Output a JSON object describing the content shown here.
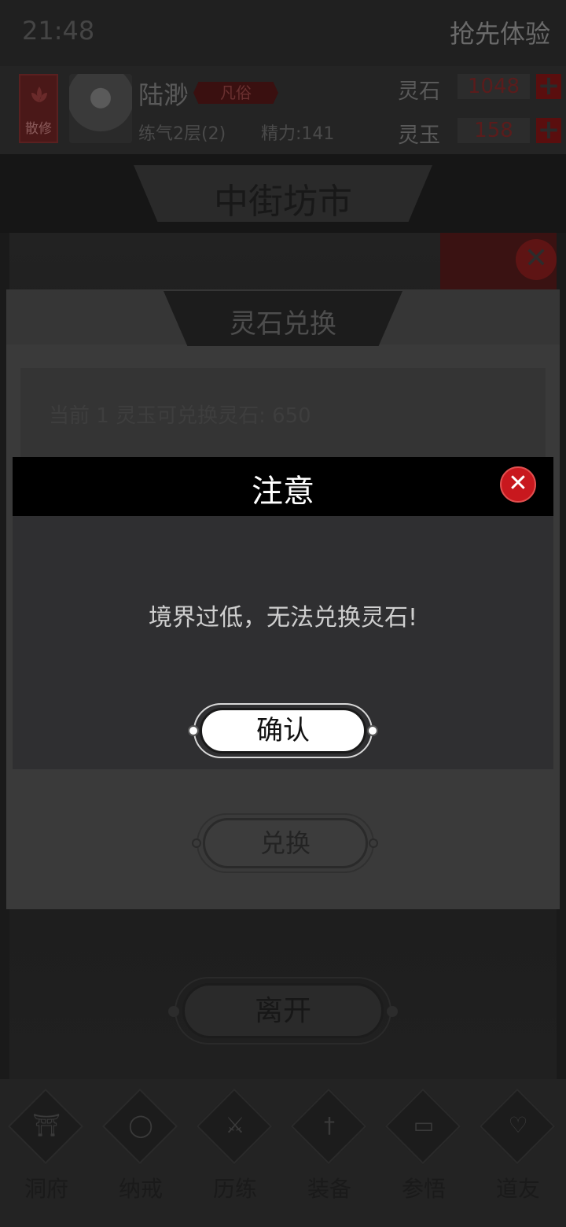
{
  "status": {
    "time": "21:48",
    "right_text": "抢先体验"
  },
  "player": {
    "sect": "散修",
    "name": "陆渺",
    "rank": "凡俗",
    "level": "练气2层(2)",
    "energy": "精力:141"
  },
  "currencies": [
    {
      "label": "灵石",
      "value": "1048",
      "plus": "+"
    },
    {
      "label": "灵玉",
      "value": "158",
      "plus": "+"
    }
  ],
  "location": {
    "title": "中街坊市"
  },
  "exchange_panel": {
    "title": "灵石兑换",
    "rate_text": "当前 1 灵玉可兑换灵石: 650",
    "exchange_button": "兑换",
    "close_glyph": "✕"
  },
  "leave_button": "离开",
  "bottom_nav": [
    {
      "label": "洞府",
      "icon": "gate-icon"
    },
    {
      "label": "纳戒",
      "icon": "ring-icon"
    },
    {
      "label": "历练",
      "icon": "crossed-swords-icon"
    },
    {
      "label": "装备",
      "icon": "sword-icon"
    },
    {
      "label": "参悟",
      "icon": "book-icon"
    },
    {
      "label": "道友",
      "icon": "heart-icon"
    }
  ],
  "dialog": {
    "title": "注意",
    "message": "境界过低，无法兑换灵石!",
    "confirm": "确认",
    "close_glyph": "✕"
  },
  "colors": {
    "dialog_close": "#c8181e",
    "overlay": "#1a1a1a",
    "accent_red": "#5a0e0e"
  }
}
